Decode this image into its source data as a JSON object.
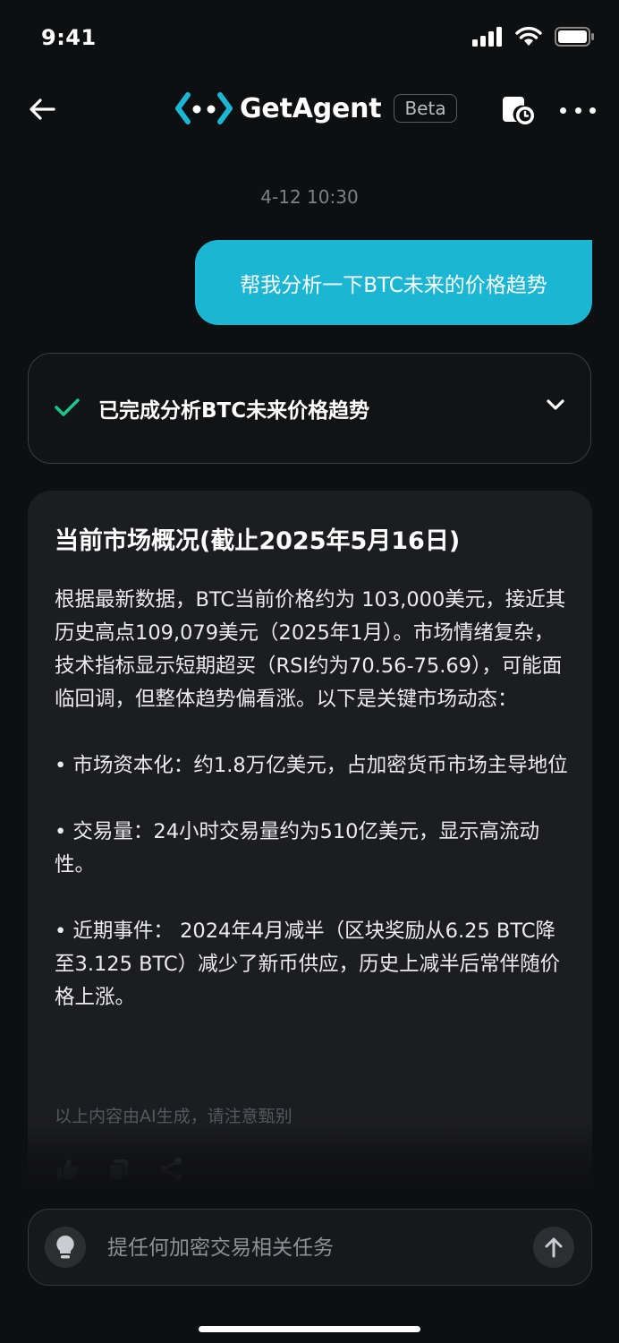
{
  "status_bar": {
    "time": "9:41"
  },
  "header": {
    "app_name": "GetAgent",
    "badge": "Beta"
  },
  "conversation": {
    "timestamp": "4-12 10:30",
    "user_message": "帮我分析一下BTC未来的价格趋势",
    "status": {
      "label": "已完成分析BTC未来价格趋势",
      "state": "completed"
    },
    "answer": {
      "title": "当前市场概况(截止2025年5月16日)",
      "intro": "根据最新数据，BTC当前价格约为 103,000美元，接近其历史高点109,079美元（2025年1月）。市场情绪复杂，技术指标显示短期超买（RSI约为70.56-75.69），可能面临回调，但整体趋势偏看涨。以下是关键市场动态：",
      "bullets": [
        "•  市场资本化：约1.8万亿美元，占加密货币市场主导地位",
        "•  交易量：24小时交易量约为510亿美元，显示高流动性。",
        "•  近期事件： 2024年4月减半（区块奖励从6.25 BTC降至3.125 BTC）减少了新币供应，历史上减半后常伴随价格上涨。"
      ],
      "disclaimer": "以上内容由AI生成，请注意甄别"
    }
  },
  "input": {
    "placeholder": "提任何加密交易相关任务"
  },
  "colors": {
    "accent": "#1bb6d4",
    "success": "#19c58c",
    "background": "#0e0f10",
    "card": "#1c1d20"
  }
}
